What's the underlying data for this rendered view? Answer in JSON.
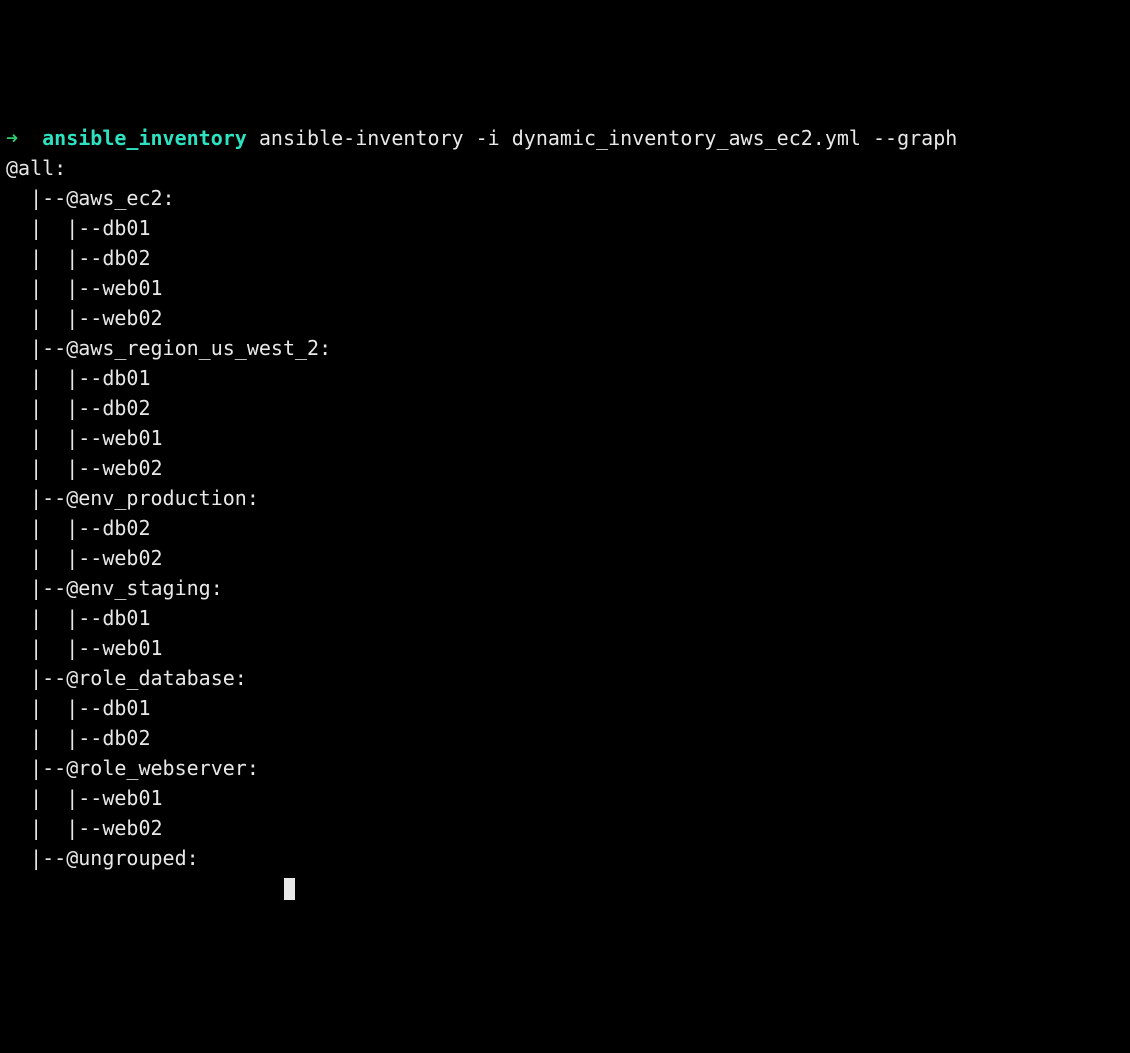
{
  "prompt": {
    "arrow": "➜",
    "dir": "ansible_inventory",
    "command": "ansible-inventory -i dynamic_inventory_aws_ec2.yml --graph"
  },
  "root": "@all:",
  "groups": [
    {
      "name": "@aws_ec2:",
      "hosts": [
        "db01",
        "db02",
        "web01",
        "web02"
      ]
    },
    {
      "name": "@aws_region_us_west_2:",
      "hosts": [
        "db01",
        "db02",
        "web01",
        "web02"
      ]
    },
    {
      "name": "@env_production:",
      "hosts": [
        "db02",
        "web02"
      ]
    },
    {
      "name": "@env_staging:",
      "hosts": [
        "db01",
        "web01"
      ]
    },
    {
      "name": "@role_database:",
      "hosts": [
        "db01",
        "db02"
      ]
    },
    {
      "name": "@role_webserver:",
      "hosts": [
        "web01",
        "web02"
      ]
    },
    {
      "name": "@ungrouped:",
      "hosts": []
    }
  ],
  "tree": {
    "group_prefix": "|--",
    "host_prefix": "|  |--"
  }
}
